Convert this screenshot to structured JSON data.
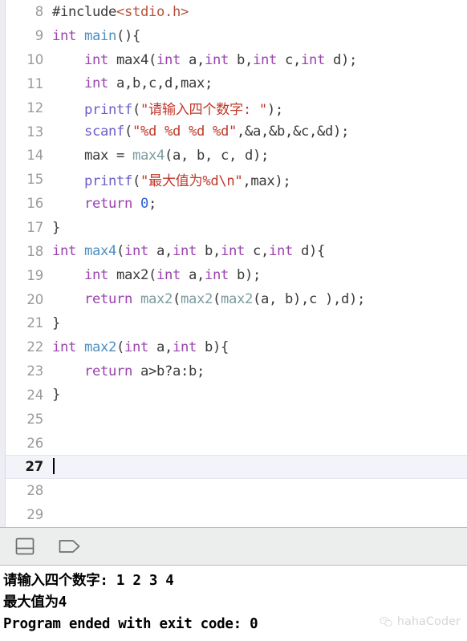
{
  "editor": {
    "first_line_number": 8,
    "current_line": 27,
    "lines": [
      {
        "n": 8,
        "tokens": [
          {
            "t": "#include",
            "c": "pln"
          },
          {
            "t": "<stdio.h>",
            "c": "hdr"
          }
        ]
      },
      {
        "n": 9,
        "tokens": [
          {
            "t": "int ",
            "c": "kw"
          },
          {
            "t": "main",
            "c": "fnb"
          },
          {
            "t": "(){",
            "c": "pln"
          }
        ]
      },
      {
        "n": 10,
        "tokens": [
          {
            "t": "    ",
            "c": "pln"
          },
          {
            "t": "int ",
            "c": "kw"
          },
          {
            "t": "max4(",
            "c": "pln"
          },
          {
            "t": "int ",
            "c": "kw"
          },
          {
            "t": "a,",
            "c": "pln"
          },
          {
            "t": "int ",
            "c": "kw"
          },
          {
            "t": "b,",
            "c": "pln"
          },
          {
            "t": "int ",
            "c": "kw"
          },
          {
            "t": "c,",
            "c": "pln"
          },
          {
            "t": "int ",
            "c": "kw"
          },
          {
            "t": "d);",
            "c": "pln"
          }
        ]
      },
      {
        "n": 11,
        "tokens": [
          {
            "t": "    ",
            "c": "pln"
          },
          {
            "t": "int ",
            "c": "kw"
          },
          {
            "t": "a,b,c,d,max;",
            "c": "pln"
          }
        ]
      },
      {
        "n": 12,
        "tokens": [
          {
            "t": "    ",
            "c": "pln"
          },
          {
            "t": "printf",
            "c": "fnp"
          },
          {
            "t": "(",
            "c": "pln"
          },
          {
            "t": "\"请输入四个数字: \"",
            "c": "str"
          },
          {
            "t": ");",
            "c": "pln"
          }
        ]
      },
      {
        "n": 13,
        "tokens": [
          {
            "t": "    ",
            "c": "pln"
          },
          {
            "t": "scanf",
            "c": "fnp"
          },
          {
            "t": "(",
            "c": "pln"
          },
          {
            "t": "\"%d %d %d %d\"",
            "c": "str"
          },
          {
            "t": ",&a,&b,&c,&d);",
            "c": "pln"
          }
        ]
      },
      {
        "n": 14,
        "tokens": [
          {
            "t": "    max = ",
            "c": "pln"
          },
          {
            "t": "max4",
            "c": "fng"
          },
          {
            "t": "(a, b, c, d);",
            "c": "pln"
          }
        ]
      },
      {
        "n": 15,
        "tokens": [
          {
            "t": "    ",
            "c": "pln"
          },
          {
            "t": "printf",
            "c": "fnp"
          },
          {
            "t": "(",
            "c": "pln"
          },
          {
            "t": "\"最大值为%d\\n\"",
            "c": "str"
          },
          {
            "t": ",max);",
            "c": "pln"
          }
        ]
      },
      {
        "n": 16,
        "tokens": [
          {
            "t": "    ",
            "c": "pln"
          },
          {
            "t": "return ",
            "c": "kw"
          },
          {
            "t": "0",
            "c": "num"
          },
          {
            "t": ";",
            "c": "pln"
          }
        ]
      },
      {
        "n": 17,
        "tokens": [
          {
            "t": "}",
            "c": "pln"
          }
        ]
      },
      {
        "n": 18,
        "tokens": [
          {
            "t": "int ",
            "c": "kw"
          },
          {
            "t": "max4",
            "c": "fnb"
          },
          {
            "t": "(",
            "c": "pln"
          },
          {
            "t": "int ",
            "c": "kw"
          },
          {
            "t": "a,",
            "c": "pln"
          },
          {
            "t": "int ",
            "c": "kw"
          },
          {
            "t": "b,",
            "c": "pln"
          },
          {
            "t": "int ",
            "c": "kw"
          },
          {
            "t": "c,",
            "c": "pln"
          },
          {
            "t": "int ",
            "c": "kw"
          },
          {
            "t": "d){",
            "c": "pln"
          }
        ]
      },
      {
        "n": 19,
        "tokens": [
          {
            "t": "    ",
            "c": "pln"
          },
          {
            "t": "int ",
            "c": "kw"
          },
          {
            "t": "max2(",
            "c": "pln"
          },
          {
            "t": "int ",
            "c": "kw"
          },
          {
            "t": "a,",
            "c": "pln"
          },
          {
            "t": "int ",
            "c": "kw"
          },
          {
            "t": "b);",
            "c": "pln"
          }
        ]
      },
      {
        "n": 20,
        "tokens": [
          {
            "t": "    ",
            "c": "pln"
          },
          {
            "t": "return ",
            "c": "kw"
          },
          {
            "t": "max2",
            "c": "fng"
          },
          {
            "t": "(",
            "c": "pln"
          },
          {
            "t": "max2",
            "c": "fng"
          },
          {
            "t": "(",
            "c": "pln"
          },
          {
            "t": "max2",
            "c": "fng"
          },
          {
            "t": "(a, b),c ),d);",
            "c": "pln"
          }
        ]
      },
      {
        "n": 21,
        "tokens": [
          {
            "t": "}",
            "c": "pln"
          }
        ]
      },
      {
        "n": 22,
        "tokens": [
          {
            "t": "int ",
            "c": "kw"
          },
          {
            "t": "max2",
            "c": "fnb"
          },
          {
            "t": "(",
            "c": "pln"
          },
          {
            "t": "int ",
            "c": "kw"
          },
          {
            "t": "a,",
            "c": "pln"
          },
          {
            "t": "int ",
            "c": "kw"
          },
          {
            "t": "b){",
            "c": "pln"
          }
        ]
      },
      {
        "n": 23,
        "tokens": [
          {
            "t": "    ",
            "c": "pln"
          },
          {
            "t": "return ",
            "c": "kw"
          },
          {
            "t": "a>b?a:b;",
            "c": "pln"
          }
        ]
      },
      {
        "n": 24,
        "tokens": [
          {
            "t": "}",
            "c": "pln"
          }
        ]
      },
      {
        "n": 25,
        "tokens": []
      },
      {
        "n": 26,
        "tokens": []
      },
      {
        "n": 27,
        "tokens": []
      },
      {
        "n": 28,
        "tokens": []
      },
      {
        "n": 29,
        "tokens": []
      }
    ]
  },
  "toolbar": {
    "icons": [
      {
        "name": "split-panel-icon",
        "label": "Show/Hide Debug Area"
      },
      {
        "name": "filter-tag-icon",
        "label": "Filter"
      }
    ]
  },
  "console": {
    "lines": [
      "请输入四个数字: 1 2 3 4",
      "最大值为4",
      "Program ended with exit code: 0"
    ]
  },
  "watermark": {
    "text": "hahaCoder",
    "icon": "wechat-icon"
  },
  "colors": {
    "keyword": "#9b42b0",
    "function_blue": "#4e8fc0",
    "function_purple": "#6b5fc9",
    "function_gray": "#7d9ba0",
    "string": "#c0392b",
    "header": "#b5513c",
    "number": "#2b5fd9",
    "plain": "#3a3a3a",
    "line_number": "#9a9a9e",
    "current_line_bg": "#f2f4fa",
    "toolbar_bg": "#eceeee",
    "console_text": "#000000"
  }
}
